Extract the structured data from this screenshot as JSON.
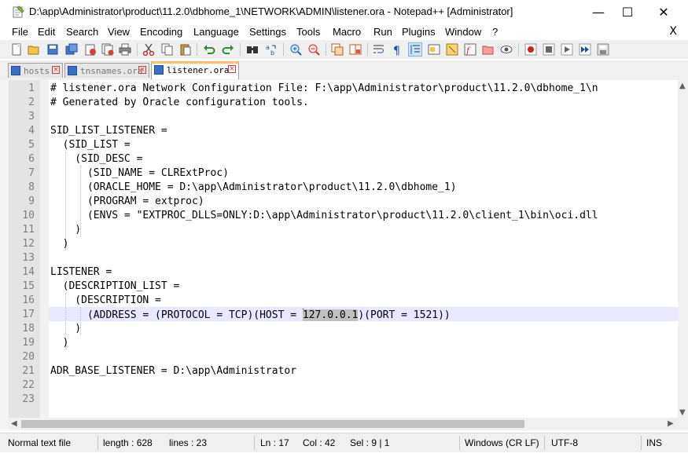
{
  "window": {
    "title": "D:\\app\\Administrator\\product\\11.2.0\\dbhome_1\\NETWORK\\ADMIN\\listener.ora - Notepad++ [Administrator]",
    "minimize": "—",
    "maximize": "☐",
    "close": "✕"
  },
  "menu": {
    "items": [
      "File",
      "Edit",
      "Search",
      "View",
      "Encoding",
      "Language",
      "Settings",
      "Tools",
      "Macro",
      "Run",
      "Plugins",
      "Window",
      "?"
    ],
    "close": "X"
  },
  "tabs": [
    {
      "label": "hosts",
      "active": false
    },
    {
      "label": "tnsnames.ora",
      "active": false
    },
    {
      "label": "listener.ora",
      "active": true
    }
  ],
  "editor": {
    "line_numbers": [
      "1",
      "2",
      "3",
      "4",
      "5",
      "6",
      "7",
      "8",
      "9",
      "10",
      "11",
      "12",
      "13",
      "14",
      "15",
      "16",
      "17",
      "18",
      "19",
      "20",
      "21",
      "22",
      "23"
    ],
    "lines": [
      "# listener.ora Network Configuration File: F:\\app\\Administrator\\product\\11.2.0\\dbhome_1\\n",
      "# Generated by Oracle configuration tools.",
      "",
      "SID_LIST_LISTENER =",
      "  (SID_LIST =",
      "    (SID_DESC =",
      "      (SID_NAME = CLRExtProc)",
      "      (ORACLE_HOME = D:\\app\\Administrator\\product\\11.2.0\\dbhome_1)",
      "      (PROGRAM = extproc)",
      "      (ENVS = \"EXTPROC_DLLS=ONLY:D:\\app\\Administrator\\product\\11.2.0\\client_1\\bin\\oci.dll",
      "    )",
      "  )",
      "",
      "LISTENER =",
      "  (DESCRIPTION_LIST =",
      "    (DESCRIPTION =",
      "",
      "    )",
      "  )",
      "",
      "ADR_BASE_LISTENER = D:\\app\\Administrator",
      "",
      ""
    ],
    "line17_before": "      (ADDRESS = (PROTOCOL = TCP)(HOST = ",
    "line17_selected": "127.0.0.1",
    "line17_after": ")(PORT = 1521))"
  },
  "status": {
    "file_type": "Normal text file",
    "length": "length : 628",
    "lines": "lines : 23",
    "ln": "Ln : 17",
    "col": "Col : 42",
    "sel": "Sel : 9 | 1",
    "eol": "Windows (CR LF)",
    "encoding": "UTF-8",
    "mode": "INS"
  },
  "colors": {
    "current_line": "#e8e8ff",
    "selection": "#c0c0c0",
    "active_tab_accent": "#fbc070",
    "gutter": "#e4e4e4"
  }
}
